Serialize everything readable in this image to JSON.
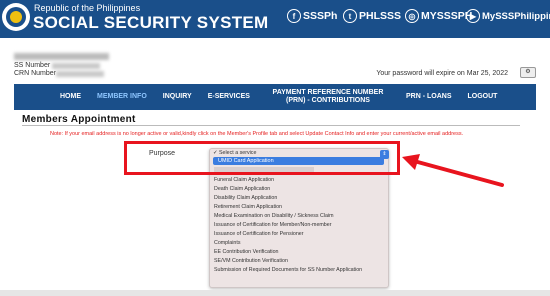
{
  "header": {
    "republic": "Republic of the Philippines",
    "title": "SOCIAL SECURITY SYSTEM",
    "socials": [
      {
        "icon": "facebook-icon",
        "label": "SSSPh"
      },
      {
        "icon": "twitter-icon",
        "label": "PHLSSS"
      },
      {
        "icon": "instagram-icon",
        "label": "MYSSSPH"
      },
      {
        "icon": "youtube-icon",
        "label": "MySSSPhilippines"
      }
    ]
  },
  "member": {
    "ss_label": "SS Number",
    "crn_label": "CRN Number",
    "password_notice": "Your password will expire on Mar 25, 2022"
  },
  "nav": [
    {
      "label": "HOME",
      "active": false
    },
    {
      "label": "MEMBER INFO",
      "active": true
    },
    {
      "label": "INQUIRY",
      "active": false
    },
    {
      "label": "E-SERVICES",
      "active": false
    },
    {
      "label": "PAYMENT REFERENCE NUMBER (PRN) - CONTRIBUTIONS",
      "active": false
    },
    {
      "label": "PRN - LOANS",
      "active": false
    },
    {
      "label": "LOGOUT",
      "active": false
    }
  ],
  "content": {
    "section_title": "Members Appointment",
    "note": "Note: If your email address is no longer active or valid,kindly click on the Member's Profile tab and select Update Contact Info and enter your current/active email address.",
    "purpose_label": "Purpose",
    "dropdown": {
      "placeholder": "Select a service",
      "selected": "UMID Card Application",
      "options": [
        "Funeral Claim Application",
        "Death Claim Application",
        "Disability Claim Application",
        "Retirement Claim Application",
        "Medical Examination on Disability / Sickness Claim",
        "Issuance of Certification for Member/Non-member",
        "Issuance of Certification for Pensioner",
        "Complaints",
        "EE Contribution Verification",
        "SE/VM Contribution Verification",
        "Submission of Required Documents for SS Number Application"
      ]
    }
  },
  "colors": {
    "brand_blue": "#1a4f8a",
    "alert_red": "#e8141e",
    "selection_blue": "#3b7de0"
  }
}
